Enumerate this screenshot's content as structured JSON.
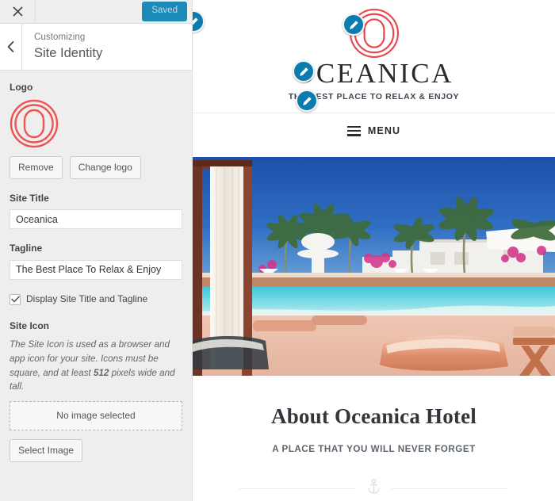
{
  "customizer": {
    "close_label": "×",
    "close_icon": "close-icon",
    "saved_button": "Saved",
    "back_icon": "chevron-left-icon",
    "eyebrow": "Customizing",
    "panel_title": "Site Identity",
    "accent_color": "#1b8ab8",
    "sidebar_bg": "#eeeeee"
  },
  "controls": {
    "logo": {
      "label": "Logo",
      "remove_button": "Remove",
      "change_button": "Change logo",
      "logo_color": "#ef5350"
    },
    "site_title": {
      "label": "Site Title",
      "value": "Oceanica",
      "placeholder": ""
    },
    "tagline": {
      "label": "Tagline",
      "value": "The Best Place To Relax & Enjoy",
      "placeholder": ""
    },
    "display_toggle": {
      "label": "Display Site Title and Tagline",
      "checked": true
    },
    "site_icon": {
      "label": "Site Icon",
      "description_pre": "The Site Icon is used as a browser and app icon for your site. Icons must be square, and at least ",
      "description_bold": "512",
      "description_post": " pixels wide and tall.",
      "empty_state": "No image selected",
      "select_button": "Select Image"
    }
  },
  "preview": {
    "logo_icon": "oceanica-logo-icon",
    "brand_title": "OCEANICA",
    "brand_tagline": "THE BEST PLACE TO RELAX & ENJOY",
    "menu_label": "MENU",
    "menu_icon": "hamburger-icon",
    "hero_alt": "Resort swimming pool with palm trees, cabana and sun loungers",
    "about_title": "About Oceanica Hotel",
    "about_subtitle": "A PLACE THAT YOU WILL NEVER FORGET",
    "divider_icon": "anchor-icon",
    "edit_shortcuts": [
      {
        "name": "edit-logo-shortcut",
        "icon": "pencil-icon"
      },
      {
        "name": "edit-site-title-shortcut",
        "icon": "pencil-icon"
      },
      {
        "name": "edit-tagline-shortcut",
        "icon": "pencil-icon"
      },
      {
        "name": "edit-offscreen-shortcut",
        "icon": "pencil-icon"
      }
    ]
  }
}
